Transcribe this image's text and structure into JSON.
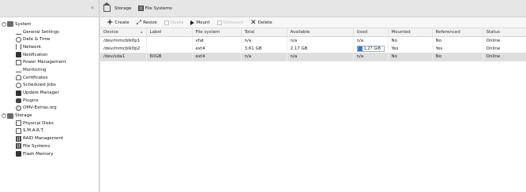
{
  "nav": {
    "collapse_glyph": "«",
    "groups": [
      {
        "label": "System",
        "items": [
          {
            "label": "General Settings",
            "icon": "wrench-icon"
          },
          {
            "label": "Date & Time",
            "icon": "clock-icon"
          },
          {
            "label": "Network",
            "icon": "network-icon"
          },
          {
            "label": "Notification",
            "icon": "mail-icon"
          },
          {
            "label": "Power Management",
            "icon": "power-icon"
          },
          {
            "label": "Monitoring",
            "icon": "chart-icon"
          },
          {
            "label": "Certificates",
            "icon": "certificate-icon"
          },
          {
            "label": "Scheduled Jobs",
            "icon": "clock-icon"
          },
          {
            "label": "Update Manager",
            "icon": "update-icon"
          },
          {
            "label": "Plugins",
            "icon": "puzzle-icon"
          },
          {
            "label": "OMV-Extras.org",
            "icon": "globe-icon"
          }
        ]
      },
      {
        "label": "Storage",
        "items": [
          {
            "label": "Physical Disks",
            "icon": "disk-icon"
          },
          {
            "label": "S.M.A.R.T.",
            "icon": "smart-icon"
          },
          {
            "label": "RAID Management",
            "icon": "raid-icon"
          },
          {
            "label": "File Systems",
            "icon": "filesystem-icon"
          },
          {
            "label": "Flash Memory",
            "icon": "flash-icon"
          }
        ]
      }
    ]
  },
  "breadcrumb": {
    "items": [
      "Storage",
      "File Systems"
    ]
  },
  "toolbar": {
    "create": "Create",
    "resize": "Resize",
    "quota": "Quota",
    "mount": "Mount",
    "unmount": "Unmount",
    "delete": "Delete"
  },
  "table": {
    "columns": [
      "Device",
      "Label",
      "File system",
      "Total",
      "Available",
      "Used",
      "Mounted",
      "Referenced",
      "Status"
    ],
    "rows": [
      {
        "device": "/dev/mmcblk0p1",
        "label": "",
        "fs": "vfat",
        "total": "n/a",
        "available": "n/a",
        "used": "n/a",
        "mounted": "No",
        "referenced": "No",
        "status": "Online",
        "selected": false
      },
      {
        "device": "/dev/mmcblk0p2",
        "label": "",
        "fs": "ext4",
        "total": "3.61 GB",
        "available": "2.17 GB",
        "used": "1.27 GiB",
        "used_fraction": 0.2,
        "mounted": "Yes",
        "referenced": "Yes",
        "status": "Online",
        "selected": false
      },
      {
        "device": "/dev/sda1",
        "label": "60GB",
        "fs": "ext4",
        "total": "n/a",
        "available": "n/a",
        "used": "n/a",
        "mounted": "No",
        "referenced": "No",
        "status": "Online",
        "selected": true
      }
    ]
  }
}
